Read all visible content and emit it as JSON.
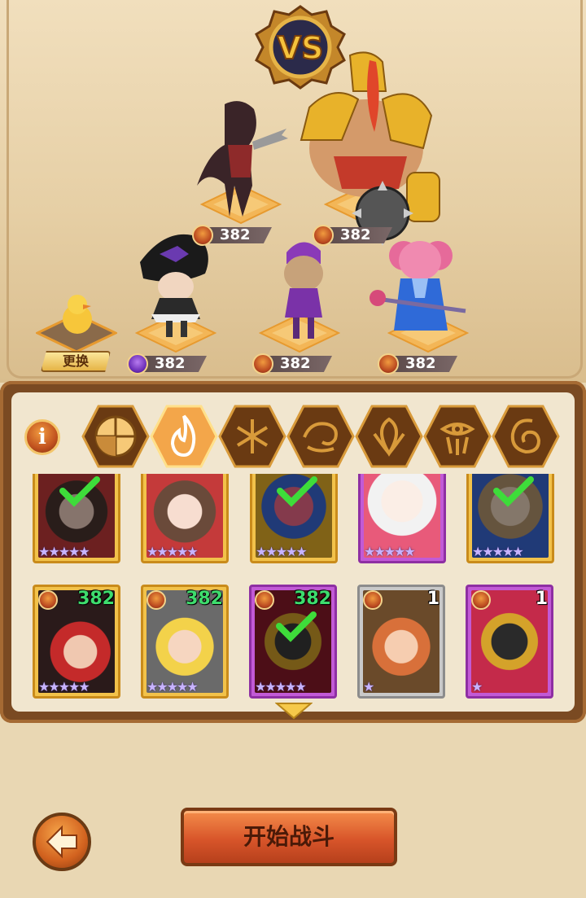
{
  "vs_label": "VS",
  "team": [
    {
      "slot": "back-left",
      "level": "382",
      "element": "fire"
    },
    {
      "slot": "back-right",
      "level": "382",
      "element": "fire"
    },
    {
      "slot": "front-1",
      "level": "382",
      "element": "void"
    },
    {
      "slot": "front-2",
      "level": "382",
      "element": "fire"
    },
    {
      "slot": "front-3",
      "level": "382",
      "element": "fire"
    }
  ],
  "swap_label": "更换",
  "info_label": "i",
  "filters": [
    "all-icon",
    "fire-icon",
    "ice-icon",
    "wind-icon",
    "nature-icon",
    "dark-icon",
    "light-icon"
  ],
  "active_filter": "fire-icon",
  "roster_row1": [
    {
      "rarity": "gold",
      "selected": true
    },
    {
      "rarity": "gold",
      "selected": false
    },
    {
      "rarity": "gold",
      "selected": true
    },
    {
      "rarity": "purple",
      "selected": false
    },
    {
      "rarity": "gold",
      "selected": true
    }
  ],
  "roster_row2": [
    {
      "rarity": "gold",
      "level": "382",
      "stars": "★★★★★",
      "selected": false
    },
    {
      "rarity": "gold",
      "level": "382",
      "stars": "★★★★★",
      "selected": false
    },
    {
      "rarity": "purple",
      "level": "382",
      "stars": "★★★★★",
      "selected": true
    },
    {
      "rarity": "grey",
      "level": "1",
      "stars": "★",
      "selected": false
    },
    {
      "rarity": "purple",
      "level": "1",
      "stars": "★",
      "selected": false
    }
  ],
  "stars_full": "★★★★★",
  "start_label": "开始战斗"
}
